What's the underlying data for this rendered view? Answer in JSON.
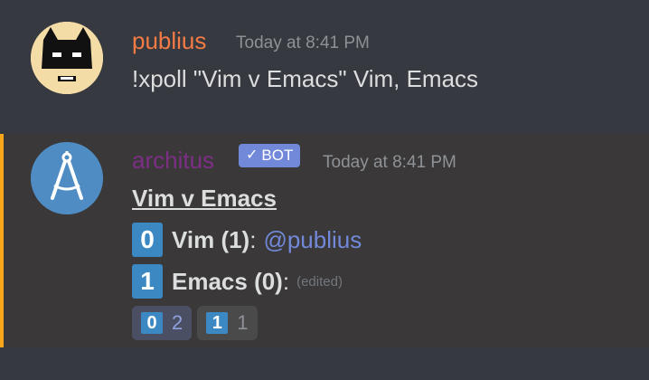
{
  "messages": [
    {
      "username": "publius",
      "timestamp": "Today at 8:41 PM",
      "content": "!xpoll \"Vim v Emacs\" Vim, Emacs",
      "avatar_icon": "batman-mask-icon",
      "username_color": "#f47b45"
    },
    {
      "username": "architus",
      "bot_tag": "BOT",
      "bot_check": "✓",
      "timestamp": "Today at 8:41 PM",
      "avatar_icon": "compass-icon",
      "username_color": "#7d2f86",
      "poll": {
        "title": "Vim v Emacs",
        "options": [
          {
            "number": "0",
            "label": "Vim (1)",
            "colon": ":",
            "detail": "@publius"
          },
          {
            "number": "1",
            "label": "Emacs (0)",
            "colon": ":",
            "detail": "(edited)"
          }
        ],
        "reactions": [
          {
            "emoji": "0",
            "count": "2",
            "active": true
          },
          {
            "emoji": "1",
            "count": "1",
            "active": false
          }
        ]
      }
    }
  ],
  "colors": {
    "background": "#36393f",
    "accent_bar": "#faa61a",
    "keycap_blue": "#3b88c3",
    "mention": "#7289da"
  }
}
